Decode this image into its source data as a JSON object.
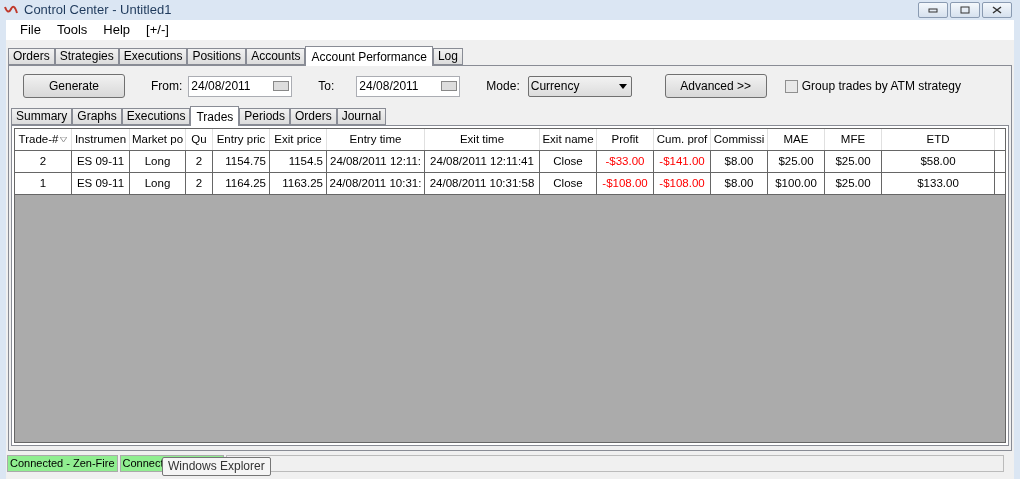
{
  "window": {
    "title": "Control Center - Untitled1"
  },
  "menu": [
    "File",
    "Tools",
    "Help",
    "[+/-]"
  ],
  "tabs": [
    {
      "label": "Orders",
      "selected": false
    },
    {
      "label": "Strategies",
      "selected": false
    },
    {
      "label": "Executions",
      "selected": false
    },
    {
      "label": "Positions",
      "selected": false
    },
    {
      "label": "Accounts",
      "selected": false
    },
    {
      "label": "Account Performance",
      "selected": true
    },
    {
      "label": "Log",
      "selected": false
    }
  ],
  "controls": {
    "generate": "Generate",
    "from_label": "From:",
    "from": "24/08/2011",
    "to_label": "To:",
    "to": "24/08/2011",
    "mode_label": "Mode:",
    "mode": "Currency",
    "advanced": "Advanced >>",
    "group_label": "Group trades by ATM strategy",
    "group_checked": false
  },
  "subtabs": [
    {
      "label": "Summary",
      "selected": false
    },
    {
      "label": "Graphs",
      "selected": false
    },
    {
      "label": "Executions",
      "selected": false
    },
    {
      "label": "Trades",
      "selected": true
    },
    {
      "label": "Periods",
      "selected": false
    },
    {
      "label": "Orders",
      "selected": false
    },
    {
      "label": "Journal",
      "selected": false
    }
  ],
  "table": {
    "columns": [
      {
        "label": "Trade-#",
        "sorted": true
      },
      {
        "label": "Instrumen",
        "sorted": false
      },
      {
        "label": "Market po",
        "sorted": false
      },
      {
        "label": "Qu",
        "sorted": false
      },
      {
        "label": "Entry pric",
        "sorted": false
      },
      {
        "label": "Exit price",
        "sorted": false
      },
      {
        "label": "Entry time",
        "sorted": false
      },
      {
        "label": "Exit time",
        "sorted": false
      },
      {
        "label": "Exit name",
        "sorted": false
      },
      {
        "label": "Profit",
        "sorted": false
      },
      {
        "label": "Cum. prof",
        "sorted": false
      },
      {
        "label": "Commissi",
        "sorted": false
      },
      {
        "label": "MAE",
        "sorted": false
      },
      {
        "label": "MFE",
        "sorted": false
      },
      {
        "label": "ETD",
        "sorted": false
      }
    ],
    "rows": [
      {
        "cells": [
          {
            "text": "2"
          },
          {
            "text": "ES 09-11"
          },
          {
            "text": "Long"
          },
          {
            "text": "2"
          },
          {
            "text": "1154.75"
          },
          {
            "text": "1154.5"
          },
          {
            "text": "24/08/2011 12:11:"
          },
          {
            "text": "24/08/2011 12:11:41"
          },
          {
            "text": "Close"
          },
          {
            "text": "-$33.00",
            "loss": true
          },
          {
            "text": "-$141.00",
            "loss": true
          },
          {
            "text": "$8.00"
          },
          {
            "text": "$25.00"
          },
          {
            "text": "$25.00"
          },
          {
            "text": "$58.00"
          }
        ]
      },
      {
        "cells": [
          {
            "text": "1"
          },
          {
            "text": "ES 09-11"
          },
          {
            "text": "Long"
          },
          {
            "text": "2"
          },
          {
            "text": "1164.25"
          },
          {
            "text": "1163.25"
          },
          {
            "text": "24/08/2011 10:31:"
          },
          {
            "text": "24/08/2011 10:31:58"
          },
          {
            "text": "Close"
          },
          {
            "text": "-$108.00",
            "loss": true
          },
          {
            "text": "-$108.00",
            "loss": true
          },
          {
            "text": "$8.00"
          },
          {
            "text": "$100.00"
          },
          {
            "text": "$25.00"
          },
          {
            "text": "$133.00"
          }
        ]
      }
    ]
  },
  "status_bar": [
    "Connected - Zen-Fire",
    "Connect"
  ],
  "tooltip": "Windows Explorer"
}
